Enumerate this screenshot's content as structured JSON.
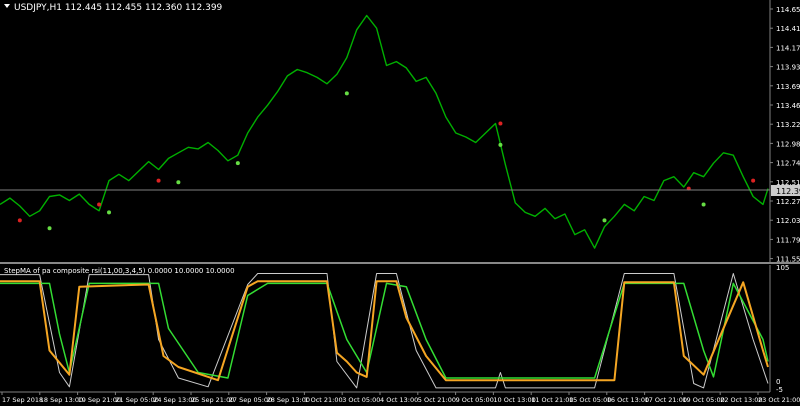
{
  "chart_title": "USDJPY,H1  112.445 112.455 112.360 112.399",
  "indicator_title": "StepMA of pa composite rsi(11,00,3,4,5) 0.0000 10.0000 10.0000",
  "price_axis": [
    "114.650",
    "114.410",
    "114.170",
    "113.935",
    "113.695",
    "113.460",
    "113.220",
    "112.985",
    "112.745",
    "112.510",
    "112.270",
    "112.035",
    "111.795",
    "111.555"
  ],
  "current_price": "112.399",
  "indicator_axis": [
    "105",
    "0",
    "-5"
  ],
  "time_axis": [
    "17 Sep 2018",
    "18 Sep 13:00",
    "19 Sep 21:00",
    "21 Sep 05:00",
    "24 Sep 13:00",
    "25 Sep 21:00",
    "27 Sep 05:00",
    "28 Sep 13:00",
    "1 Oct 21:00",
    "3 Oct 05:00",
    "4 Oct 13:00",
    "5 Oct 21:00",
    "9 Oct 05:00",
    "10 Oct 13:00",
    "11 Oct 21:00",
    "15 Oct 05:00",
    "16 Oct 13:00",
    "17 Oct 21:00",
    "19 Oct 05:00",
    "22 Oct 13:00",
    "23 Oct 21:00"
  ],
  "colors": {
    "background": "#000000",
    "price_line": "#00b000",
    "bullish_dot": "#66dd44",
    "bearish_dot": "#dd2222",
    "indicator_step": "#f5a623",
    "indicator_green": "#33dd33",
    "indicator_white": "#cccccc",
    "axis_text": "#ffffff",
    "grid": "#808080"
  },
  "chart_data": {
    "type": "line",
    "price": {
      "y_range": [
        111.5,
        114.7
      ],
      "points": [
        [
          0,
          112.2
        ],
        [
          2,
          112.28
        ],
        [
          4,
          112.18
        ],
        [
          6,
          112.05
        ],
        [
          8,
          112.12
        ],
        [
          10,
          112.3
        ],
        [
          12,
          112.32
        ],
        [
          14,
          112.25
        ],
        [
          16,
          112.33
        ],
        [
          18,
          112.2
        ],
        [
          20,
          112.12
        ],
        [
          22,
          112.5
        ],
        [
          24,
          112.58
        ],
        [
          26,
          112.5
        ],
        [
          28,
          112.62
        ],
        [
          30,
          112.74
        ],
        [
          32,
          112.64
        ],
        [
          34,
          112.78
        ],
        [
          36,
          112.85
        ],
        [
          38,
          112.92
        ],
        [
          40,
          112.9
        ],
        [
          42,
          112.98
        ],
        [
          44,
          112.88
        ],
        [
          46,
          112.75
        ],
        [
          48,
          112.82
        ],
        [
          50,
          113.1
        ],
        [
          52,
          113.3
        ],
        [
          54,
          113.45
        ],
        [
          56,
          113.62
        ],
        [
          58,
          113.82
        ],
        [
          60,
          113.9
        ],
        [
          62,
          113.86
        ],
        [
          64,
          113.8
        ],
        [
          66,
          113.72
        ],
        [
          68,
          113.84
        ],
        [
          70,
          114.05
        ],
        [
          72,
          114.4
        ],
        [
          74,
          114.58
        ],
        [
          76,
          114.42
        ],
        [
          78,
          113.95
        ],
        [
          80,
          114.0
        ],
        [
          82,
          113.92
        ],
        [
          84,
          113.75
        ],
        [
          86,
          113.8
        ],
        [
          88,
          113.6
        ],
        [
          90,
          113.3
        ],
        [
          92,
          113.1
        ],
        [
          94,
          113.05
        ],
        [
          96,
          112.98
        ],
        [
          98,
          113.1
        ],
        [
          100,
          113.22
        ],
        [
          102,
          112.7
        ],
        [
          104,
          112.22
        ],
        [
          106,
          112.1
        ],
        [
          108,
          112.05
        ],
        [
          110,
          112.15
        ],
        [
          112,
          112.02
        ],
        [
          114,
          112.08
        ],
        [
          116,
          111.82
        ],
        [
          118,
          111.88
        ],
        [
          120,
          111.65
        ],
        [
          122,
          111.92
        ],
        [
          124,
          112.05
        ],
        [
          126,
          112.2
        ],
        [
          128,
          112.12
        ],
        [
          130,
          112.3
        ],
        [
          132,
          112.25
        ],
        [
          134,
          112.5
        ],
        [
          136,
          112.55
        ],
        [
          138,
          112.42
        ],
        [
          140,
          112.6
        ],
        [
          142,
          112.55
        ],
        [
          144,
          112.72
        ],
        [
          146,
          112.85
        ],
        [
          148,
          112.82
        ],
        [
          150,
          112.55
        ],
        [
          152,
          112.3
        ],
        [
          154,
          112.2
        ],
        [
          155,
          112.4
        ]
      ]
    },
    "dots": {
      "green": [
        [
          10,
          111.9
        ],
        [
          22,
          112.1
        ],
        [
          36,
          112.48
        ],
        [
          48,
          112.72
        ],
        [
          70,
          113.6
        ],
        [
          101,
          112.95
        ],
        [
          122,
          112.0
        ],
        [
          142,
          112.2
        ]
      ],
      "red": [
        [
          4,
          112.0
        ],
        [
          20,
          112.2
        ],
        [
          32,
          112.5
        ],
        [
          101,
          113.22
        ],
        [
          139,
          112.4
        ],
        [
          152,
          112.5
        ]
      ]
    },
    "indicator": {
      "y_range": [
        -5,
        105
      ],
      "step": [
        [
          0,
          93
        ],
        [
          8,
          93
        ],
        [
          10,
          30
        ],
        [
          14,
          8
        ],
        [
          16,
          88
        ],
        [
          30,
          90
        ],
        [
          33,
          25
        ],
        [
          36,
          15
        ],
        [
          44,
          3
        ],
        [
          50,
          88
        ],
        [
          52,
          93
        ],
        [
          66,
          93
        ],
        [
          68,
          28
        ],
        [
          70,
          20
        ],
        [
          72,
          10
        ],
        [
          74,
          6
        ],
        [
          76,
          93
        ],
        [
          80,
          93
        ],
        [
          82,
          60
        ],
        [
          86,
          25
        ],
        [
          90,
          3
        ],
        [
          100,
          3
        ],
        [
          102,
          3
        ],
        [
          110,
          3
        ],
        [
          120,
          3
        ],
        [
          124,
          3
        ],
        [
          126,
          92
        ],
        [
          136,
          92
        ],
        [
          138,
          25
        ],
        [
          142,
          8
        ],
        [
          150,
          92
        ],
        [
          154,
          30
        ],
        [
          155,
          15
        ]
      ],
      "green": [
        [
          0,
          91
        ],
        [
          10,
          91
        ],
        [
          12,
          45
        ],
        [
          14,
          10
        ],
        [
          18,
          91
        ],
        [
          32,
          91
        ],
        [
          34,
          50
        ],
        [
          40,
          10
        ],
        [
          46,
          5
        ],
        [
          50,
          80
        ],
        [
          54,
          91
        ],
        [
          66,
          91
        ],
        [
          70,
          40
        ],
        [
          74,
          10
        ],
        [
          78,
          91
        ],
        [
          82,
          88
        ],
        [
          86,
          40
        ],
        [
          90,
          5
        ],
        [
          104,
          5
        ],
        [
          120,
          5
        ],
        [
          126,
          91
        ],
        [
          138,
          91
        ],
        [
          142,
          30
        ],
        [
          144,
          6
        ],
        [
          148,
          91
        ],
        [
          154,
          40
        ],
        [
          155,
          20
        ]
      ],
      "white": [
        [
          0,
          99
        ],
        [
          8,
          99
        ],
        [
          12,
          10
        ],
        [
          14,
          -3
        ],
        [
          18,
          99
        ],
        [
          30,
          99
        ],
        [
          32,
          40
        ],
        [
          36,
          5
        ],
        [
          42,
          -3
        ],
        [
          50,
          90
        ],
        [
          52,
          100
        ],
        [
          66,
          100
        ],
        [
          68,
          20
        ],
        [
          72,
          -4
        ],
        [
          76,
          100
        ],
        [
          80,
          100
        ],
        [
          84,
          30
        ],
        [
          88,
          -4
        ],
        [
          100,
          -4
        ],
        [
          101,
          10
        ],
        [
          102,
          -4
        ],
        [
          120,
          -4
        ],
        [
          126,
          100
        ],
        [
          136,
          100
        ],
        [
          140,
          0
        ],
        [
          142,
          -4
        ],
        [
          148,
          100
        ],
        [
          152,
          40
        ],
        [
          155,
          0
        ]
      ]
    }
  }
}
